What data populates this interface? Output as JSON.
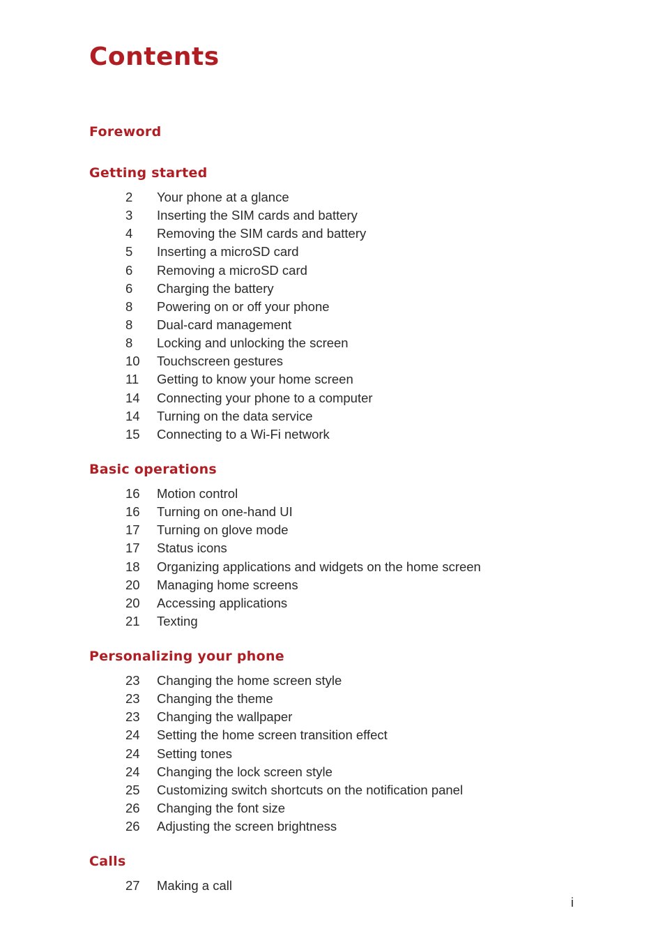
{
  "document": {
    "title": "Contents",
    "page_number": "i",
    "accent_color": "#b01e24",
    "sections": [
      {
        "heading": "Foreword",
        "entries": []
      },
      {
        "heading": "Getting started",
        "entries": [
          {
            "page": "2",
            "title": "Your phone at a glance"
          },
          {
            "page": "3",
            "title": "Inserting the SIM cards and battery"
          },
          {
            "page": "4",
            "title": "Removing the SIM cards and battery"
          },
          {
            "page": "5",
            "title": "Inserting a microSD card"
          },
          {
            "page": "6",
            "title": "Removing a microSD card"
          },
          {
            "page": "6",
            "title": "Charging the battery"
          },
          {
            "page": "8",
            "title": "Powering on or off your phone"
          },
          {
            "page": "8",
            "title": "Dual-card management"
          },
          {
            "page": "8",
            "title": "Locking and unlocking the screen"
          },
          {
            "page": "10",
            "title": "Touchscreen gestures"
          },
          {
            "page": "11",
            "title": "Getting to know your home screen"
          },
          {
            "page": "14",
            "title": "Connecting your phone to a computer"
          },
          {
            "page": "14",
            "title": "Turning on the data service"
          },
          {
            "page": "15",
            "title": "Connecting to a Wi-Fi network"
          }
        ]
      },
      {
        "heading": "Basic operations",
        "entries": [
          {
            "page": "16",
            "title": "Motion control"
          },
          {
            "page": "16",
            "title": "Turning on one-hand UI"
          },
          {
            "page": "17",
            "title": "Turning on glove mode"
          },
          {
            "page": "17",
            "title": "Status icons"
          },
          {
            "page": "18",
            "title": "Organizing applications and widgets on the home screen"
          },
          {
            "page": "20",
            "title": "Managing home screens"
          },
          {
            "page": "20",
            "title": "Accessing applications"
          },
          {
            "page": "21",
            "title": "Texting"
          }
        ]
      },
      {
        "heading": "Personalizing your phone",
        "entries": [
          {
            "page": "23",
            "title": "Changing the home screen style"
          },
          {
            "page": "23",
            "title": "Changing the theme"
          },
          {
            "page": "23",
            "title": "Changing the wallpaper"
          },
          {
            "page": "24",
            "title": "Setting the home screen transition effect"
          },
          {
            "page": "24",
            "title": "Setting tones"
          },
          {
            "page": "24",
            "title": "Changing the lock screen style"
          },
          {
            "page": "25",
            "title": "Customizing switch shortcuts on the notification panel"
          },
          {
            "page": "26",
            "title": "Changing the font size"
          },
          {
            "page": "26",
            "title": "Adjusting the screen brightness"
          }
        ]
      },
      {
        "heading": "Calls",
        "entries": [
          {
            "page": "27",
            "title": "Making a call"
          }
        ]
      }
    ]
  }
}
